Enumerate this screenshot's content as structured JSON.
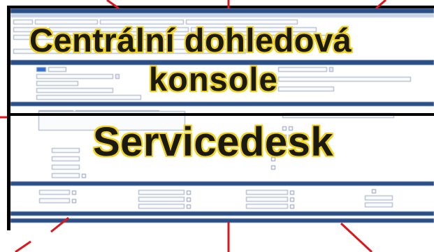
{
  "captions": {
    "top_line1": "Centrální dohledová",
    "top_line2": "konsole",
    "bottom": "Servicedesk"
  },
  "colors": {
    "frame": "#000000",
    "arrow": "#e0141b",
    "caption_fill": "#1b1a12",
    "caption_outline": "#f2d21a",
    "form_header": "#2a4f86"
  }
}
